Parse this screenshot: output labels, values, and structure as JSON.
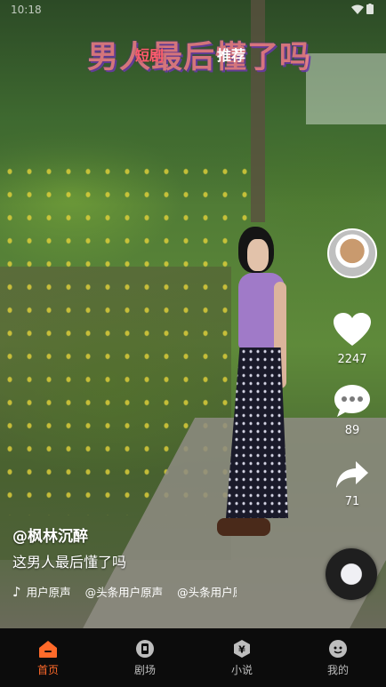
{
  "status_bar": {
    "time": "10:18"
  },
  "top_tabs": [
    {
      "label": "短剧",
      "active": false
    },
    {
      "label": "推荐",
      "active": true
    }
  ],
  "overlay_title": "男人最后懂了吗",
  "actions": {
    "like_count": "2247",
    "comment_count": "89",
    "share_count": "71"
  },
  "video_info": {
    "author": "@枫林沉醉",
    "description": "这男人最后懂了吗",
    "music": [
      "用户原声",
      "@头条用户原声",
      "@头条用户原"
    ]
  },
  "bottom_nav": [
    {
      "label": "首页",
      "icon": "home-icon",
      "active": true
    },
    {
      "label": "剧场",
      "icon": "theater-icon",
      "active": false
    },
    {
      "label": "小说",
      "icon": "novel-icon",
      "active": false
    },
    {
      "label": "我的",
      "icon": "profile-icon",
      "active": false
    }
  ],
  "colors": {
    "accent": "#ff6a2a",
    "tab_active_pink": "#ff5a6e",
    "nav_bg": "#0c0c0c"
  }
}
